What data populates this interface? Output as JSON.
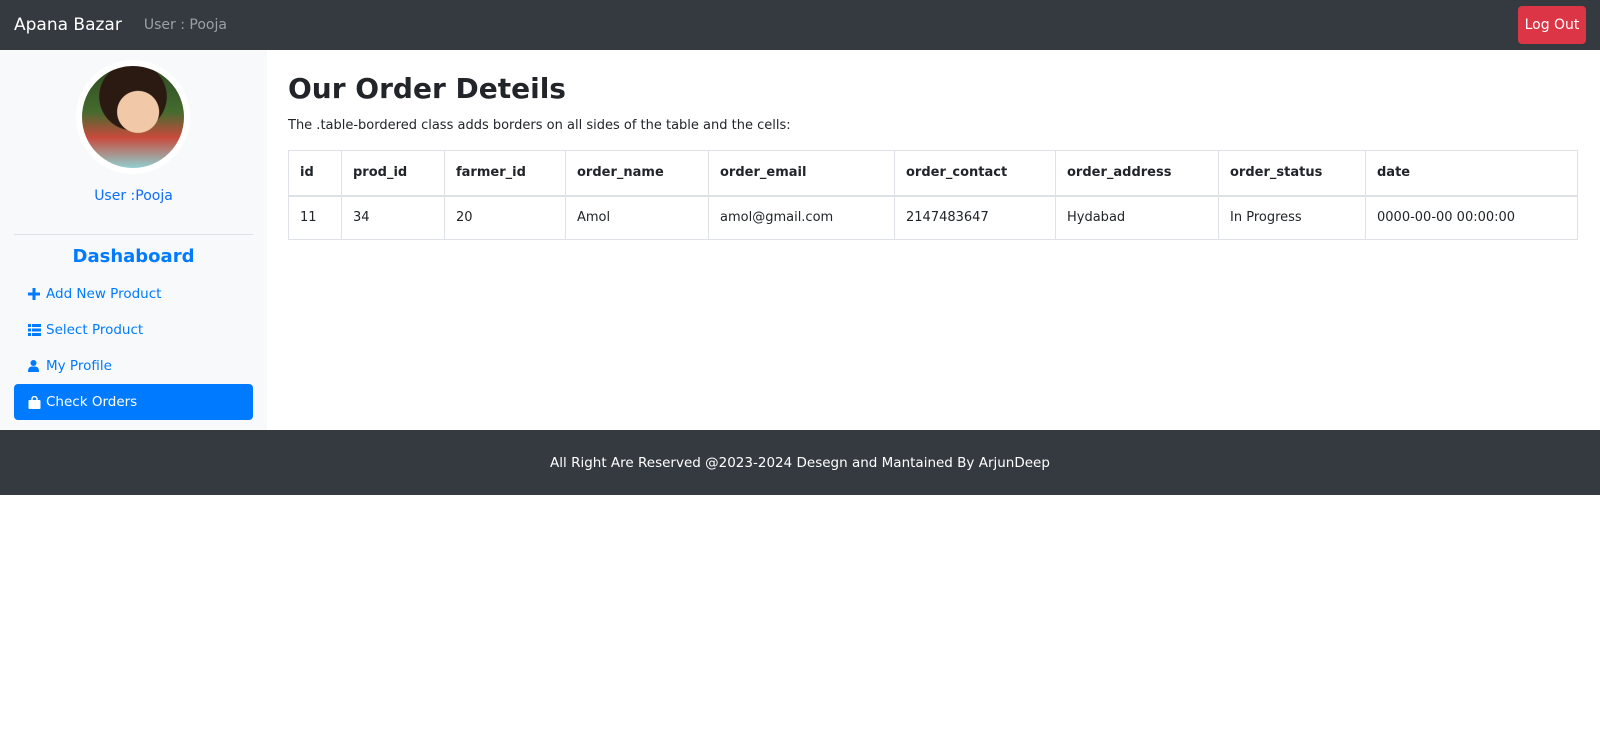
{
  "navbar": {
    "brand": "Apana Bazar",
    "user": "User : Pooja",
    "logout_label": "Log Out"
  },
  "sidebar": {
    "user_label": "User :Pooja",
    "dashboard_title": "Dashaboard",
    "items": [
      {
        "label": "Add New Product",
        "icon": "plus-icon"
      },
      {
        "label": "Select Product",
        "icon": "list-icon"
      },
      {
        "label": "My Profile",
        "icon": "user-icon"
      },
      {
        "label": "Check Orders",
        "icon": "shopping-bag-icon",
        "active": true
      }
    ]
  },
  "main": {
    "title": "Our Order Deteils",
    "description": "The .table-bordered class adds borders on all sides of the table and the cells:",
    "table": {
      "columns": [
        "id",
        "prod_id",
        "farmer_id",
        "order_name",
        "order_email",
        "order_contact",
        "order_address",
        "order_status",
        "date"
      ],
      "rows": [
        [
          "11",
          "34",
          "20",
          "Amol",
          "amol@gmail.com",
          "2147483647",
          "Hydabad",
          "In Progress",
          "0000-00-00 00:00:00"
        ]
      ]
    }
  },
  "footer": {
    "text": "All Right Are Reserved @2023-2024 Desegn and Mantained By ArjunDeep"
  },
  "colors": {
    "navbar_bg": "#343a40",
    "accent": "#007bff",
    "danger": "#dc3545",
    "sidebar_bg": "#f8f9fa"
  }
}
